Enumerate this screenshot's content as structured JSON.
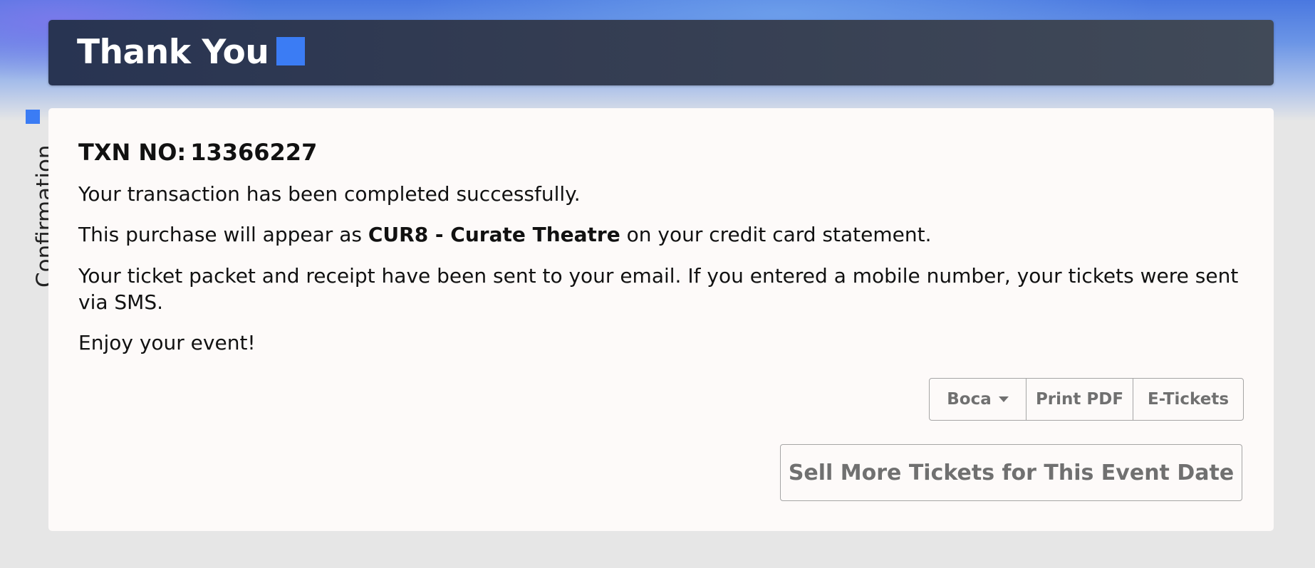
{
  "header": {
    "title": "Thank You"
  },
  "sidebar": {
    "label": "Confirmation"
  },
  "confirmation": {
    "txn_label": "TXN NO:",
    "txn_number": "13366227",
    "line_success": "Your transaction has been completed successfully.",
    "line_statement_prefix": "This purchase will appear as ",
    "line_statement_merchant": "CUR8 - Curate Theatre",
    "line_statement_suffix": " on your credit card statement.",
    "line_sent": "Your ticket packet and receipt have been sent to your email. If you entered a mobile number, your tickets were sent via SMS.",
    "line_enjoy": "Enjoy your event!"
  },
  "actions": {
    "printer_select": "Boca",
    "print_pdf": "Print PDF",
    "e_tickets": "E-Tickets",
    "sell_more": "Sell More Tickets for This Event Date"
  },
  "colors": {
    "accent": "#3b7cf4",
    "header_bg": "#2f3950",
    "card_bg": "#fdfaf9",
    "button_text": "#707070"
  }
}
